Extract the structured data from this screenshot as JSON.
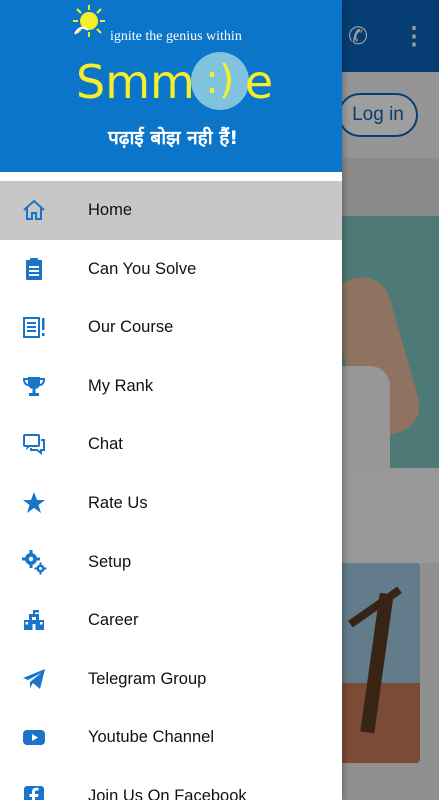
{
  "background": {
    "login_label": "Log in"
  },
  "drawer": {
    "tagline": "ignite the genius within",
    "brand_left": "Smm",
    "brand_mark": ":)",
    "brand_right": "e",
    "hindi_slogan": "पढ़ाई बोझ नही हैं!",
    "menu": [
      {
        "label": "Home",
        "icon": "home-icon",
        "active": true
      },
      {
        "label": "Can You Solve",
        "icon": "clipboard-icon",
        "active": false
      },
      {
        "label": "Our Course",
        "icon": "course-list-icon",
        "active": false
      },
      {
        "label": "My Rank",
        "icon": "trophy-icon",
        "active": false
      },
      {
        "label": "Chat",
        "icon": "chat-icon",
        "active": false
      },
      {
        "label": "Rate Us",
        "icon": "star-icon",
        "active": false
      },
      {
        "label": "Setup",
        "icon": "gears-icon",
        "active": false
      },
      {
        "label": "Career",
        "icon": "building-icon",
        "active": false
      },
      {
        "label": "Telegram Group",
        "icon": "telegram-icon",
        "active": false
      },
      {
        "label": "Youtube Channel",
        "icon": "youtube-icon",
        "active": false
      },
      {
        "label": "Join Us On Facebook",
        "icon": "facebook-icon",
        "active": false
      }
    ]
  },
  "colors": {
    "primary": "#0b75c9",
    "brand_yellow": "#f4ef2a",
    "active_row": "#c7c7c7"
  }
}
